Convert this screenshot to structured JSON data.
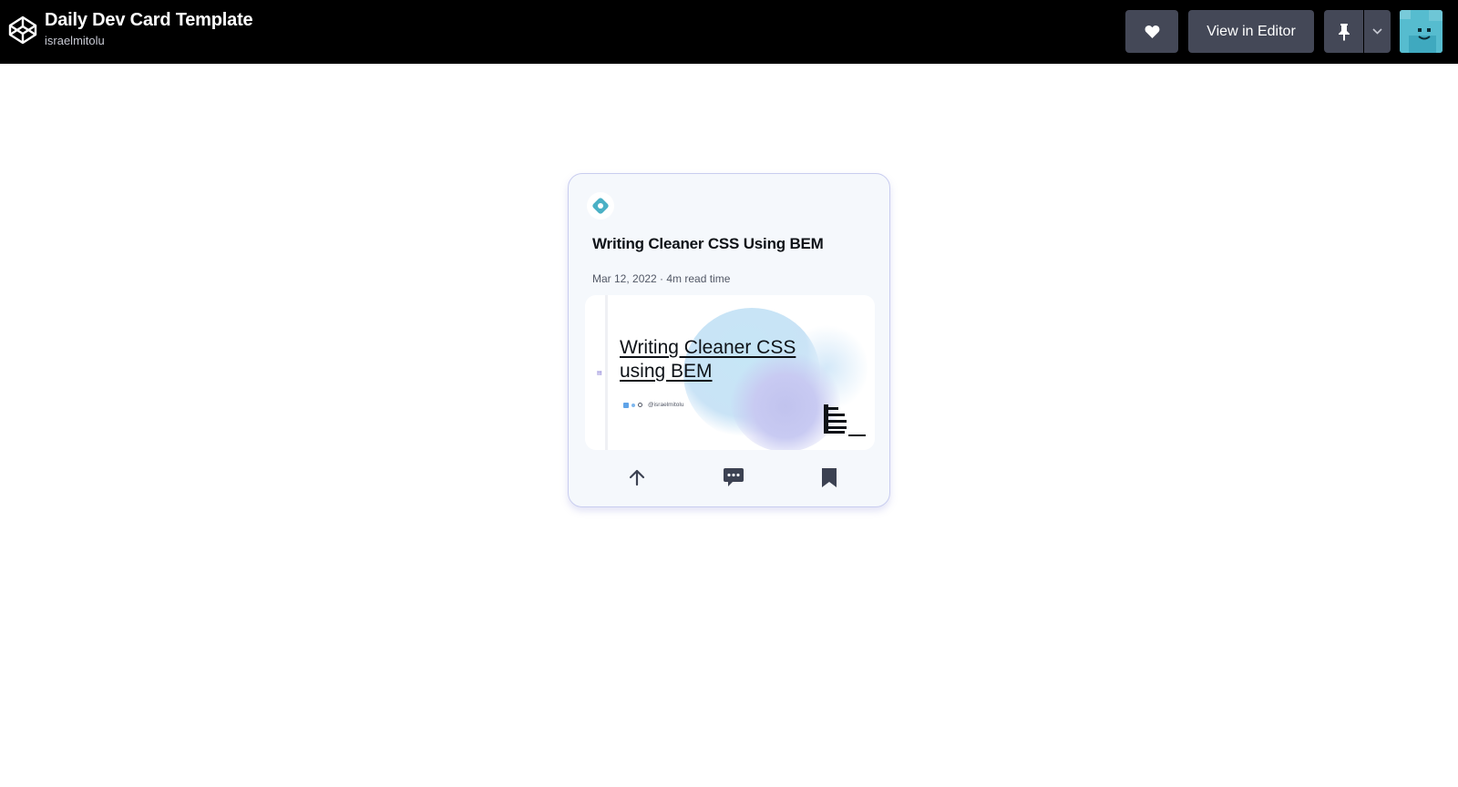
{
  "header": {
    "pen_title": "Daily Dev Card Template",
    "author": "israelmitolu",
    "view_editor_label": "View in Editor",
    "icons": [
      "codepen-logo-icon",
      "heart-icon",
      "pin-icon",
      "chevron-down-icon",
      "avatar"
    ]
  },
  "card": {
    "source_icon": "source-logo-icon",
    "title": "Writing Cleaner CSS Using BEM",
    "meta": "Mar 12, 2022 · 4m read time",
    "image": {
      "headline": "Writing Cleaner CSS using BEM",
      "handle": "@israelmitolu"
    },
    "actions": [
      "upvote-icon",
      "comment-icon",
      "bookmark-icon"
    ]
  },
  "colors": {
    "topbar": "#000000",
    "button": "#444857",
    "card_bg": "#f5f8fc",
    "card_border": "#c9cdef",
    "accent": "#4ab0c5"
  }
}
